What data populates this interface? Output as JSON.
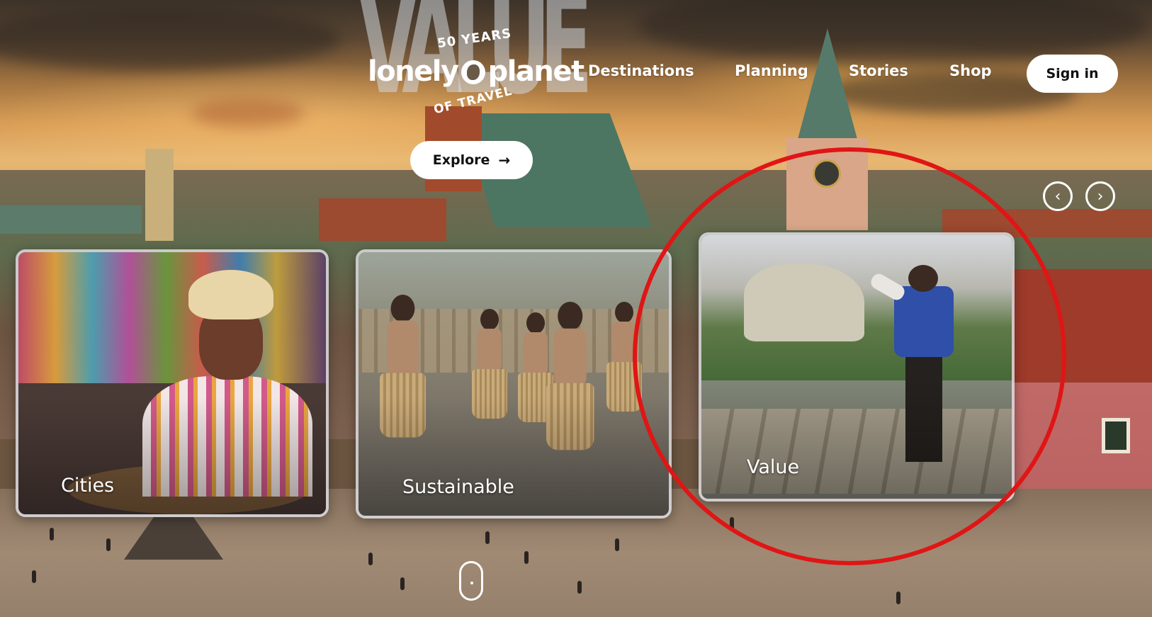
{
  "brand": {
    "logo_top": "50 YEARS",
    "logo_main_left": "lonely",
    "logo_main_right": "planet",
    "logo_bottom": "OF TRAVEL",
    "hero_word": "VALUE"
  },
  "nav": {
    "items": [
      {
        "label": "Destinations"
      },
      {
        "label": "Planning"
      },
      {
        "label": "Stories"
      },
      {
        "label": "Shop"
      }
    ],
    "sign_in": "Sign in"
  },
  "hero": {
    "explore_label": "Explore",
    "explore_icon": "arrow-right-icon"
  },
  "carousel": {
    "prev_icon": "chevron-left-icon",
    "next_icon": "chevron-right-icon",
    "cards": [
      {
        "label": "Cities"
      },
      {
        "label": "Sustainable"
      },
      {
        "label": "Value"
      }
    ]
  },
  "annotation": {
    "color": "#e01515"
  },
  "scroll_indicator_icon": "mouse-scroll-icon"
}
